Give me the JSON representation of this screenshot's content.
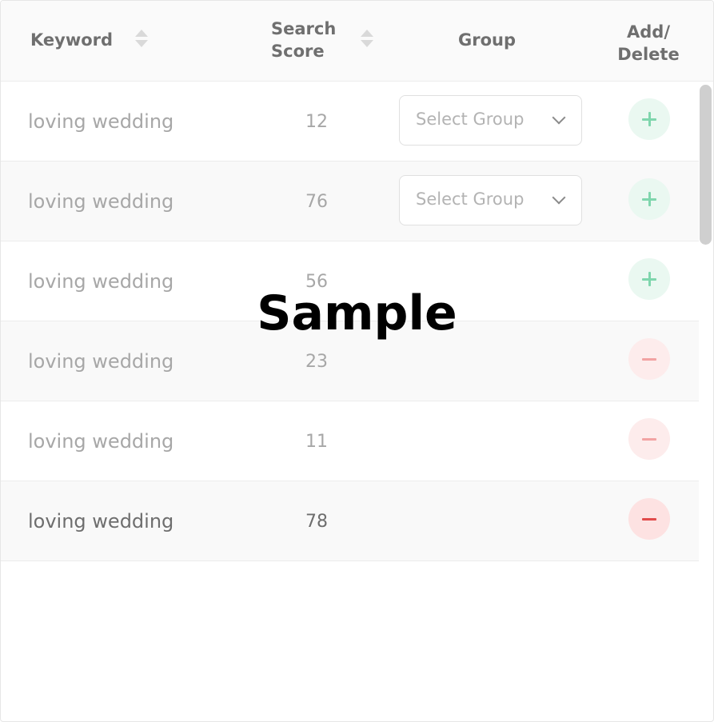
{
  "header": {
    "keyword": "Keyword",
    "search_score": "Search Score",
    "group": "Group",
    "add_delete": "Add/ Delete"
  },
  "rows": [
    {
      "keyword": "loving wedding",
      "score": "12",
      "group_placeholder": "Select Group",
      "action": "add"
    },
    {
      "keyword": "loving wedding",
      "score": "76",
      "group_placeholder": "Select Group",
      "action": "add"
    },
    {
      "keyword": "loving wedding",
      "score": "56",
      "group_placeholder": "",
      "action": "add"
    },
    {
      "keyword": "loving wedding",
      "score": "23",
      "group_placeholder": "",
      "action": "delete"
    },
    {
      "keyword": "loving wedding",
      "score": "11",
      "group_placeholder": "",
      "action": "delete"
    },
    {
      "keyword": "loving wedding",
      "score": "78",
      "group_placeholder": "",
      "action": "delete"
    }
  ],
  "watermark": "Sample",
  "colors": {
    "add_accent": "#7fd6ad",
    "delete_accent": "#e14b4b"
  },
  "icons": {
    "sort": "sort-icon",
    "chevron": "chevron-down-icon",
    "add": "plus-icon",
    "delete": "minus-icon"
  }
}
